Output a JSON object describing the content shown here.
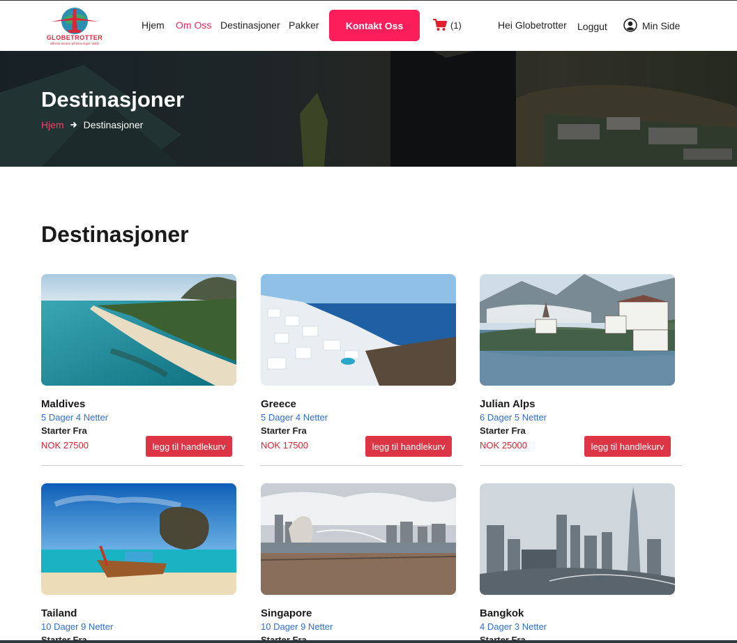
{
  "brand": {
    "name": "GLOBETROTTER",
    "tagline": "Utforsk Verden på Dine Egne Vilkår",
    "colors": {
      "accent": "#fb1e5b",
      "price": "#e02030",
      "link": "#2f6fd0",
      "button": "#dc3545"
    }
  },
  "nav": {
    "home": "Hjem",
    "about": "Om Oss",
    "destinations": "Destinasjoner",
    "packages": "Pakker",
    "contact": "Kontakt Oss",
    "cart_count": "(1)",
    "greeting": "Hei Globetrotter",
    "logout": "Loggut",
    "my_page": "Min Side"
  },
  "hero": {
    "title": "Destinasjoner",
    "breadcrumb_home": "Hjem",
    "breadcrumb_current": "Destinasjoner"
  },
  "section": {
    "title": "Destinasjoner"
  },
  "destinations": [
    {
      "name": "Maldives",
      "duration": "5 Dager 4 Netter",
      "start_label": "Starter Fra",
      "price": "NOK 27500",
      "button": "legg til handlekurv"
    },
    {
      "name": "Greece",
      "duration": "5 Dager 4 Netter",
      "start_label": "Starter Fra",
      "price": "NOK 17500",
      "button": "legg til handlekurv"
    },
    {
      "name": "Julian Alps",
      "duration": "6 Dager 5 Netter",
      "start_label": "Starter Fra",
      "price": "NOK 25000",
      "button": "legg til handlekurv"
    },
    {
      "name": "Tailand",
      "duration": "10 Dager 9 Netter",
      "start_label": "Starter Fra"
    },
    {
      "name": "Singapore",
      "duration": "10 Dager 9 Netter",
      "start_label": "Starter Fra"
    },
    {
      "name": "Bangkok",
      "duration": "4 Dager 3 Netter",
      "start_label": "Starter Fra"
    }
  ]
}
